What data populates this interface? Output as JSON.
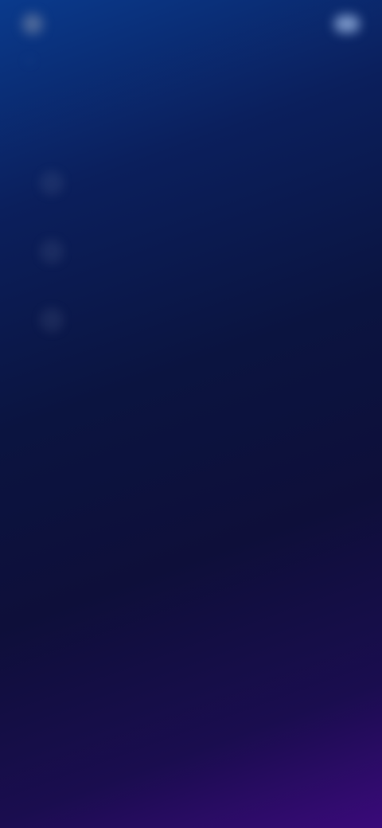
{
  "header": {
    "brand_name": "",
    "action_label": ""
  },
  "breadcrumb": {
    "back_icon": "arrow-left-icon",
    "link_text": ""
  },
  "page": {
    "title": ""
  },
  "options": [
    {
      "label": ""
    },
    {
      "label": ""
    },
    {
      "label": ""
    }
  ],
  "colors": {
    "accent": "#2ec4d8",
    "gradient_top": "#0a3a8c",
    "gradient_bottom": "#3a0a7a"
  }
}
